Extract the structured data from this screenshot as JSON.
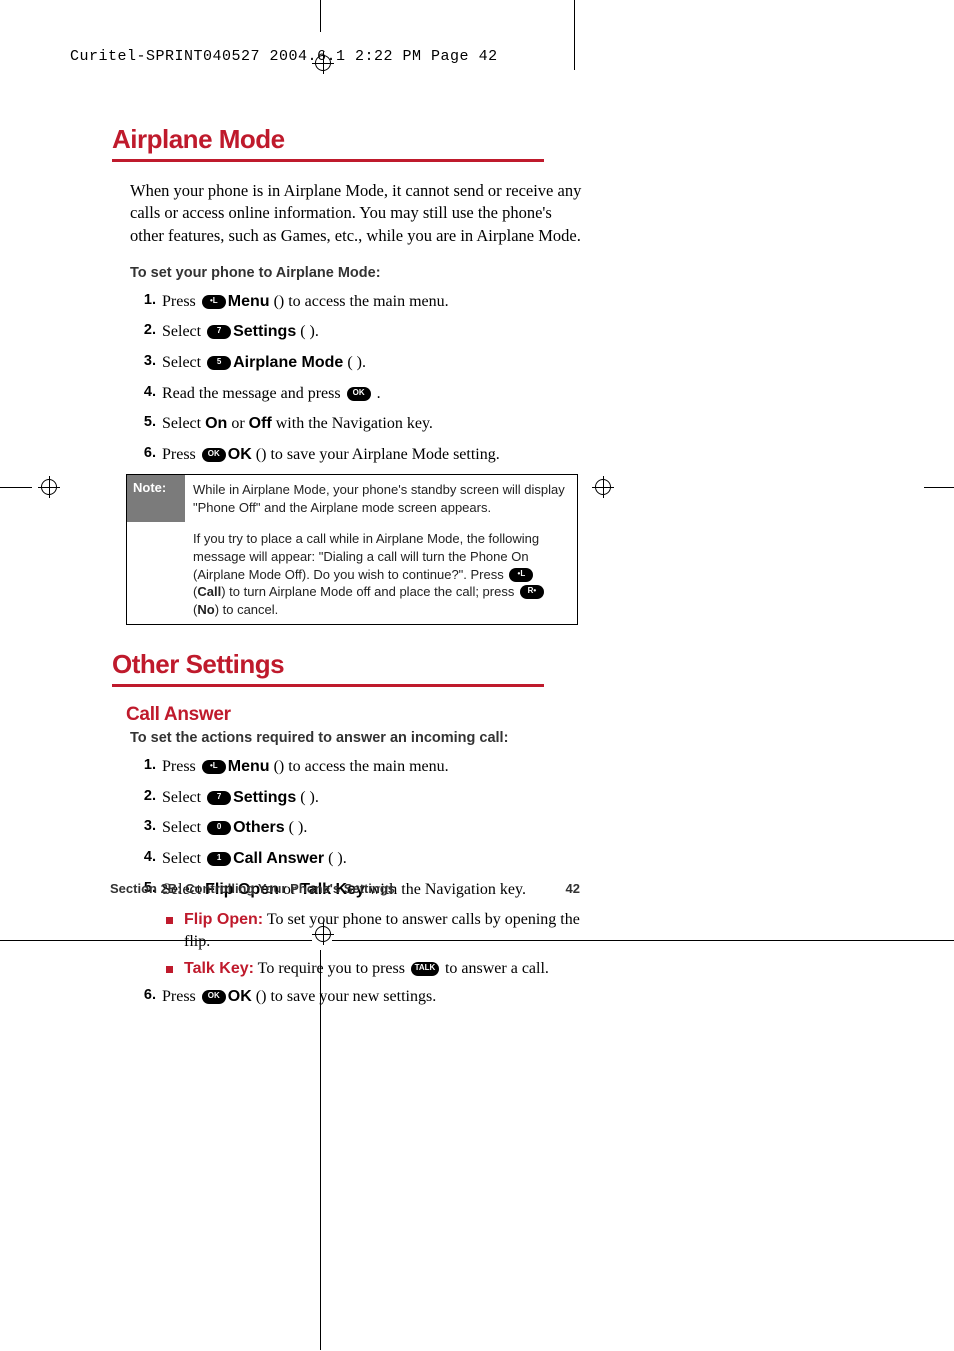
{
  "slug": "Curitel-SPRINT040527  2004.6.1  2:22 PM  Page 42",
  "h1a": "Airplane Mode",
  "intro_a": "When your phone is in Airplane Mode, it cannot send or receive any calls or access online information. You may still use the phone's other features, such as Games, etc., while you are in Airplane Mode.",
  "lead_a": "To set your phone to Airplane Mode:",
  "steps_a": [
    {
      "n": "1.",
      "pre": "Press ",
      "icon": "soft-left",
      "mid": " (",
      "bold": "Menu",
      "post": ") to access the main menu."
    },
    {
      "n": "2.",
      "pre": "Select ",
      "bold": "Settings",
      "mid": " ( ",
      "icon": "key-7",
      "post": " )."
    },
    {
      "n": "3.",
      "pre": "Select ",
      "bold": "Airplane Mode",
      "mid": " ( ",
      "icon": "key-5",
      "post": " )."
    },
    {
      "n": "4.",
      "pre": "Read the message and press ",
      "icon": "ok-key",
      "post": " ."
    },
    {
      "n": "5.",
      "pre": "Select ",
      "bold": "On",
      "mid": " or ",
      "bold2": "Off",
      "post": " with the Navigation key."
    },
    {
      "n": "6.",
      "pre": "Press ",
      "icon": "ok-key",
      "mid": " (",
      "bold": "OK",
      "post": ") to save your Airplane Mode setting."
    }
  ],
  "note_label": "Note:",
  "note_p1": "While in Airplane Mode, your phone's standby screen will display \"Phone Off\" and the Airplane mode screen appears.",
  "note_p2a": "If you try to place a call while in Airplane Mode, the following message will appear: \"Dialing a call will turn the Phone On (Airplane Mode Off). Do you wish to continue?\".  Press ",
  "note_p2_icon1": "soft-left",
  "note_p2b": " (",
  "note_p2_bold1": "Call",
  "note_p2c": ") to turn Airplane Mode off and place the call; press ",
  "note_p2_icon2": "soft-right",
  "note_p2d": " (",
  "note_p2_bold2": "No",
  "note_p2e": ") to cancel.",
  "h1b": "Other Settings",
  "h2b": "Call Answer",
  "lead_b": "To set the actions required to answer an incoming call:",
  "steps_b": [
    {
      "n": "1.",
      "pre": "Press ",
      "icon": "soft-left",
      "mid": " (",
      "bold": "Menu",
      "post": ") to access the main menu."
    },
    {
      "n": "2.",
      "pre": "Select ",
      "bold": "Settings",
      "mid": " ( ",
      "icon": "key-7",
      "post": " )."
    },
    {
      "n": "3.",
      "pre": "Select ",
      "bold": "Others",
      "mid": " ( ",
      "icon": "key-0",
      "post": " )."
    },
    {
      "n": "4.",
      "pre": "Select ",
      "bold": "Call Answer",
      "mid": " ( ",
      "icon": "key-1",
      "post": " )."
    },
    {
      "n": "5.",
      "pre": "Select ",
      "bold": "Flip Open",
      "mid": " or ",
      "bold2": "Talk Key",
      "post": " with the Navigation key."
    },
    {
      "n": "6.",
      "pre": "Press ",
      "icon": "ok-key",
      "mid": " (",
      "bold": "OK",
      "post": ") to save your new settings."
    }
  ],
  "bullets_b": [
    {
      "bold": "Flip Open:",
      "text": " To set your phone to answer calls by opening the flip."
    },
    {
      "bold": "Talk Key:",
      "text_pre": " To require you to press ",
      "icon": "talk-key",
      "text_post": " to answer a call."
    }
  ],
  "footer_left": "Section 2B: Controlling Your Phone's Settings",
  "footer_right": "42",
  "icons": {
    "soft-left": "•L",
    "soft-right": "R•",
    "ok-key": "OK",
    "talk-key": "TALK",
    "key-0": "0",
    "key-1": "1",
    "key-5": "5",
    "key-7": "7"
  }
}
